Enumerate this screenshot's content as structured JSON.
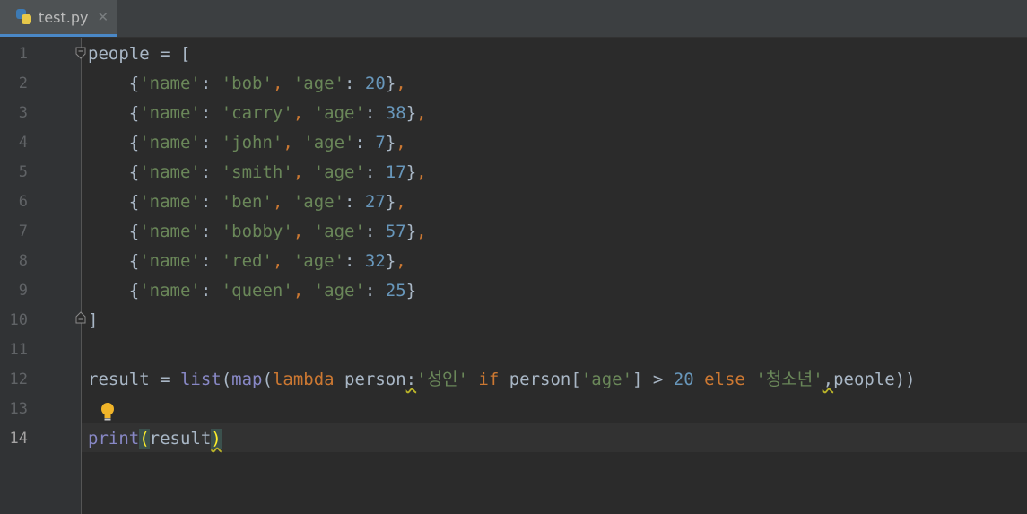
{
  "tab": {
    "filename": "test.py",
    "close_glyph": "✕",
    "icon": "python-file-icon"
  },
  "lines": [
    {
      "n": "1",
      "tokens": [
        [
          "plain",
          "people = ["
        ]
      ]
    },
    {
      "n": "2",
      "tokens": [
        [
          "plain",
          "    {"
        ],
        [
          "str",
          "'name'"
        ],
        [
          "plain",
          ": "
        ],
        [
          "str",
          "'bob'"
        ],
        [
          "kw",
          ", "
        ],
        [
          "str",
          "'age'"
        ],
        [
          "plain",
          ": "
        ],
        [
          "num",
          "20"
        ],
        [
          "plain",
          "}"
        ],
        [
          "kw",
          ","
        ]
      ]
    },
    {
      "n": "3",
      "tokens": [
        [
          "plain",
          "    {"
        ],
        [
          "str",
          "'name'"
        ],
        [
          "plain",
          ": "
        ],
        [
          "str",
          "'carry'"
        ],
        [
          "kw",
          ", "
        ],
        [
          "str",
          "'age'"
        ],
        [
          "plain",
          ": "
        ],
        [
          "num",
          "38"
        ],
        [
          "plain",
          "}"
        ],
        [
          "kw",
          ","
        ]
      ]
    },
    {
      "n": "4",
      "tokens": [
        [
          "plain",
          "    {"
        ],
        [
          "str",
          "'name'"
        ],
        [
          "plain",
          ": "
        ],
        [
          "str",
          "'john'"
        ],
        [
          "kw",
          ", "
        ],
        [
          "str",
          "'age'"
        ],
        [
          "plain",
          ": "
        ],
        [
          "num",
          "7"
        ],
        [
          "plain",
          "}"
        ],
        [
          "kw",
          ","
        ]
      ]
    },
    {
      "n": "5",
      "tokens": [
        [
          "plain",
          "    {"
        ],
        [
          "str",
          "'name'"
        ],
        [
          "plain",
          ": "
        ],
        [
          "str",
          "'smith'"
        ],
        [
          "kw",
          ", "
        ],
        [
          "str",
          "'age'"
        ],
        [
          "plain",
          ": "
        ],
        [
          "num",
          "17"
        ],
        [
          "plain",
          "}"
        ],
        [
          "kw",
          ","
        ]
      ]
    },
    {
      "n": "6",
      "tokens": [
        [
          "plain",
          "    {"
        ],
        [
          "str",
          "'name'"
        ],
        [
          "plain",
          ": "
        ],
        [
          "str",
          "'ben'"
        ],
        [
          "kw",
          ", "
        ],
        [
          "str",
          "'age'"
        ],
        [
          "plain",
          ": "
        ],
        [
          "num",
          "27"
        ],
        [
          "plain",
          "}"
        ],
        [
          "kw",
          ","
        ]
      ]
    },
    {
      "n": "7",
      "tokens": [
        [
          "plain",
          "    {"
        ],
        [
          "str",
          "'name'"
        ],
        [
          "plain",
          ": "
        ],
        [
          "str",
          "'bobby'"
        ],
        [
          "kw",
          ", "
        ],
        [
          "str",
          "'age'"
        ],
        [
          "plain",
          ": "
        ],
        [
          "num",
          "57"
        ],
        [
          "plain",
          "}"
        ],
        [
          "kw",
          ","
        ]
      ]
    },
    {
      "n": "8",
      "tokens": [
        [
          "plain",
          "    {"
        ],
        [
          "str",
          "'name'"
        ],
        [
          "plain",
          ": "
        ],
        [
          "str",
          "'red'"
        ],
        [
          "kw",
          ", "
        ],
        [
          "str",
          "'age'"
        ],
        [
          "plain",
          ": "
        ],
        [
          "num",
          "32"
        ],
        [
          "plain",
          "}"
        ],
        [
          "kw",
          ","
        ]
      ]
    },
    {
      "n": "9",
      "tokens": [
        [
          "plain",
          "    {"
        ],
        [
          "str",
          "'name'"
        ],
        [
          "plain",
          ": "
        ],
        [
          "str",
          "'queen'"
        ],
        [
          "kw",
          ", "
        ],
        [
          "str",
          "'age'"
        ],
        [
          "plain",
          ": "
        ],
        [
          "num",
          "25"
        ],
        [
          "plain",
          "}"
        ]
      ]
    },
    {
      "n": "10",
      "tokens": [
        [
          "plain",
          "]"
        ]
      ]
    },
    {
      "n": "11",
      "tokens": []
    },
    {
      "n": "12",
      "tokens": [
        [
          "plain",
          "result = "
        ],
        [
          "bi",
          "list"
        ],
        [
          "plain",
          "("
        ],
        [
          "bi",
          "map"
        ],
        [
          "plain",
          "("
        ],
        [
          "kw",
          "lambda "
        ],
        [
          "plain",
          "person"
        ],
        [
          "squig",
          ":"
        ],
        [
          "str",
          "'성인'"
        ],
        [
          "kw",
          " if "
        ],
        [
          "plain",
          "person["
        ],
        [
          "str",
          "'age'"
        ],
        [
          "plain",
          "] > "
        ],
        [
          "num",
          "20"
        ],
        [
          "kw",
          " else "
        ],
        [
          "str",
          "'청소년'"
        ],
        [
          "squig",
          ","
        ],
        [
          "plain",
          "people))"
        ]
      ]
    },
    {
      "n": "13",
      "tokens": []
    },
    {
      "n": "14",
      "tokens": [
        [
          "bi",
          "print"
        ],
        [
          "paren-hl",
          "("
        ],
        [
          "plain",
          "result"
        ],
        [
          "paren-hl squig",
          ")"
        ]
      ]
    }
  ],
  "current_line": "14",
  "colors": {
    "background": "#2b2b2b",
    "keyword": "#cc7832",
    "string": "#6a8759",
    "number": "#6897bb",
    "builtin": "#8888c6",
    "text": "#a9b7c6"
  },
  "icons": {
    "fold_open": "fold-open-icon",
    "fold_close": "fold-close-icon",
    "intention": "lightbulb-icon"
  }
}
